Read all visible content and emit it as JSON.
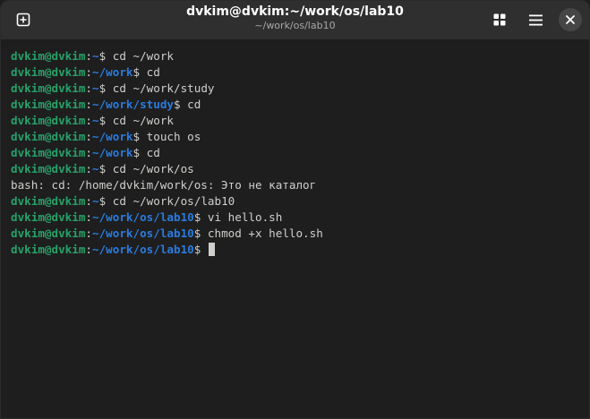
{
  "window": {
    "title": "dvkim@dvkim:~/work/os/lab10",
    "subtitle": "~/work/os/lab10"
  },
  "icons": {
    "new_tab": "new-tab-icon",
    "overview": "tab-overview-icon",
    "menu": "hamburger-menu-icon",
    "close": "close-icon"
  },
  "colors": {
    "prompt_user": "#26a269",
    "prompt_path": "#2a7bde",
    "text": "#d0cfcc",
    "background": "#1e1e1e",
    "titlebar": "#2f2f2f"
  },
  "terminal": {
    "lines": [
      {
        "type": "prompt",
        "user": "dvkim@dvkim",
        "sep": ":",
        "path": "~",
        "sym": "$",
        "cmd": " cd ~/work"
      },
      {
        "type": "prompt",
        "user": "dvkim@dvkim",
        "sep": ":",
        "path": "~/work",
        "sym": "$",
        "cmd": " cd"
      },
      {
        "type": "prompt",
        "user": "dvkim@dvkim",
        "sep": ":",
        "path": "~",
        "sym": "$",
        "cmd": " cd ~/work/study"
      },
      {
        "type": "prompt",
        "user": "dvkim@dvkim",
        "sep": ":",
        "path": "~/work/study",
        "sym": "$",
        "cmd": " cd"
      },
      {
        "type": "prompt",
        "user": "dvkim@dvkim",
        "sep": ":",
        "path": "~",
        "sym": "$",
        "cmd": " cd ~/work"
      },
      {
        "type": "prompt",
        "user": "dvkim@dvkim",
        "sep": ":",
        "path": "~/work",
        "sym": "$",
        "cmd": " touch os"
      },
      {
        "type": "prompt",
        "user": "dvkim@dvkim",
        "sep": ":",
        "path": "~/work",
        "sym": "$",
        "cmd": " cd"
      },
      {
        "type": "prompt",
        "user": "dvkim@dvkim",
        "sep": ":",
        "path": "~",
        "sym": "$",
        "cmd": " cd ~/work/os"
      },
      {
        "type": "output",
        "text": "bash: cd: /home/dvkim/work/os: Это не каталог"
      },
      {
        "type": "prompt",
        "user": "dvkim@dvkim",
        "sep": ":",
        "path": "~",
        "sym": "$",
        "cmd": " cd ~/work/os/lab10"
      },
      {
        "type": "prompt",
        "user": "dvkim@dvkim",
        "sep": ":",
        "path": "~/work/os/lab10",
        "sym": "$",
        "cmd": " vi hello.sh"
      },
      {
        "type": "prompt",
        "user": "dvkim@dvkim",
        "sep": ":",
        "path": "~/work/os/lab10",
        "sym": "$",
        "cmd": " chmod +x hello.sh"
      },
      {
        "type": "prompt",
        "user": "dvkim@dvkim",
        "sep": ":",
        "path": "~/work/os/lab10",
        "sym": "$",
        "cmd": " ",
        "cursor": true
      }
    ]
  }
}
